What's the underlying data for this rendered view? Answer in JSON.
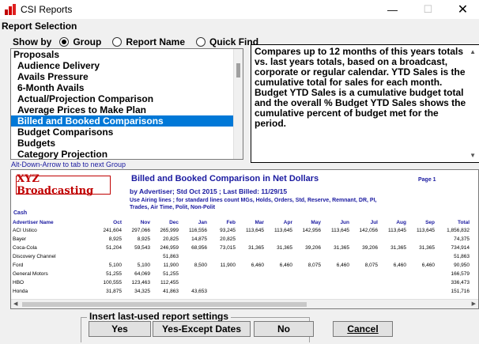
{
  "window": {
    "title": "CSI Reports",
    "minimize": "—",
    "maximize": "☐",
    "close": "✕"
  },
  "section_label": "Report Selection",
  "show_by": {
    "label": "Show by",
    "options": [
      "Group",
      "Report Name",
      "Quick Find"
    ],
    "selected": "Group"
  },
  "report_list": {
    "items": [
      {
        "label": "Proposals",
        "group": true
      },
      {
        "label": "Audience Delivery"
      },
      {
        "label": "Avails Pressure"
      },
      {
        "label": "6-Month Avails"
      },
      {
        "label": "Actual/Projection Comparison"
      },
      {
        "label": "Average Prices to Make Plan"
      },
      {
        "label": "Billed and Booked Comparisons",
        "selected": true
      },
      {
        "label": "Budget Comparisons"
      },
      {
        "label": "Budgets"
      },
      {
        "label": "Category Projection"
      }
    ]
  },
  "hint": "Alt-Down-Arrow to tab to next Group",
  "description": "Compares up to 12 months of this years totals vs. last years totals, based on a broadcast, corporate or regular calendar. YTD Sales is the cumulative total for sales for each month. Budget YTD Sales is a cumulative budget total and the overall % Budget YTD Sales shows the cumulative percent of budget met for the period.",
  "preview": {
    "logo": "XYZ Broadcasting",
    "title": "Billed and Booked Comparison in Net Dollars",
    "page": "Page 1",
    "subtitle": "by Advertiser; Std Oct 2015  ; Last Billed: 11/29/15",
    "note": "Use Airing lines ; for standard lines count MGs, Holds, Orders, Std, Reserve, Remnant, DR, PI, Trades, Air Time, Polit, Non-Polit",
    "section": "Cash",
    "columns": [
      "Advertiser Name",
      "Oct",
      "Nov",
      "Dec",
      "Jan",
      "Feb",
      "Mar",
      "Apr",
      "May",
      "Jun",
      "Jul",
      "Aug",
      "Sep",
      "Total"
    ],
    "rows": [
      [
        "ACI Ustico",
        "241,604",
        "297,066",
        "265,999",
        "116,556",
        "93,245",
        "113,645",
        "113,645",
        "142,956",
        "113,645",
        "142,056",
        "113,645",
        "113,645",
        "1,856,832"
      ],
      [
        "Bayer",
        "8,925",
        "8,925",
        "20,825",
        "14,875",
        "20,825",
        "",
        "",
        "",
        "",
        "",
        "",
        "",
        "74,375"
      ],
      [
        "Coca-Cola",
        "51,204",
        "59,543",
        "246,959",
        "68,956",
        "73,015",
        "31,365",
        "31,365",
        "39,206",
        "31,365",
        "39,206",
        "31,365",
        "31,365",
        "734,914"
      ],
      [
        "Discovery Channel",
        "",
        "",
        "51,863",
        "",
        "",
        "",
        "",
        "",
        "",
        "",
        "",
        "",
        "51,863"
      ],
      [
        "Ford",
        "5,100",
        "5,100",
        "11,900",
        "8,500",
        "11,900",
        "6,460",
        "6,460",
        "8,075",
        "6,460",
        "8,075",
        "6,460",
        "6,460",
        "90,950"
      ],
      [
        "General Motors",
        "51,255",
        "64,069",
        "51,255",
        "",
        "",
        "",
        "",
        "",
        "",
        "",
        "",
        "",
        "166,579"
      ],
      [
        "HBO",
        "100,555",
        "123,463",
        "112,455",
        "",
        "",
        "",
        "",
        "",
        "",
        "",
        "",
        "",
        "336,473"
      ],
      [
        "Honda",
        "31,875",
        "34,325",
        "41,863",
        "43,653",
        "",
        "",
        "",
        "",
        "",
        "",
        "",
        "",
        "151,716"
      ]
    ]
  },
  "settings": {
    "legend": "Insert last-used report settings",
    "yes": "Yes",
    "yes_except": "Yes-Except Dates",
    "no": "No"
  },
  "cancel": "Cancel"
}
